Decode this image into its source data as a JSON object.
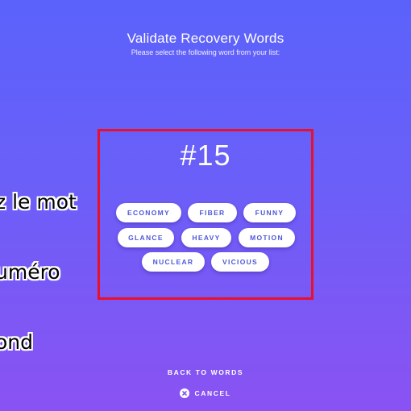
{
  "header": {
    "title": "Validate Recovery Words",
    "subtitle": "Please select the following word from your list:"
  },
  "overlay": {
    "lines": [
      "z le mot",
      "uméro",
      "ond"
    ]
  },
  "prompt": {
    "word_number": "#15"
  },
  "word_choices": [
    {
      "label": "ECONOMY"
    },
    {
      "label": "FIBER"
    },
    {
      "label": "FUNNY"
    },
    {
      "label": "GLANCE"
    },
    {
      "label": "HEAVY"
    },
    {
      "label": "MOTION"
    },
    {
      "label": "NUCLEAR"
    },
    {
      "label": "VICIOUS"
    }
  ],
  "footer": {
    "back_label": "BACK TO WORDS",
    "cancel_label": "CANCEL",
    "cancel_icon": "close-circle-icon"
  },
  "colors": {
    "background_top": "#5a62fb",
    "background_bottom": "#8a52f2",
    "highlight_border": "#e8102a",
    "chip_text": "#4f57d9"
  }
}
